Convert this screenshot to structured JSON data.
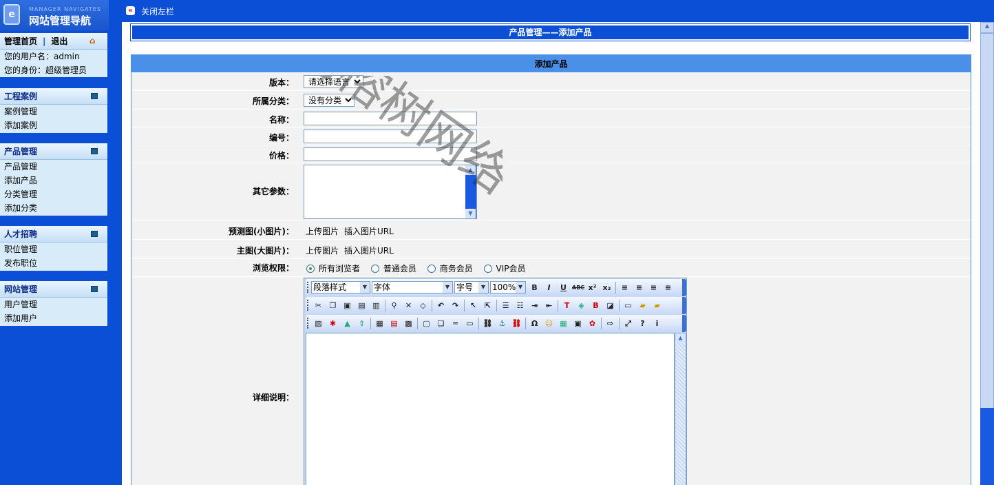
{
  "logo": {
    "sub": "MANAGER NAVIGATES",
    "title": "网站管理导航"
  },
  "sidebar": {
    "home": {
      "home_label": "管理首页",
      "logout_label": "退出",
      "username": "您的用户名：admin",
      "role": "您的身份：超级管理员"
    },
    "sections": [
      {
        "title": "工程案例",
        "items": [
          "案例管理",
          "添加案例"
        ]
      },
      {
        "title": "产品管理",
        "items": [
          "产品管理",
          "添加产品",
          "分类管理",
          "添加分类"
        ]
      },
      {
        "title": "人才招聘",
        "items": [
          "职位管理",
          "发布职位"
        ]
      },
      {
        "title": "网站管理",
        "items": [
          "用户管理",
          "添加用户"
        ]
      }
    ]
  },
  "topbar": {
    "close_label": "关闭左栏"
  },
  "page": {
    "title": "产品管理——添加产品"
  },
  "form": {
    "header": "添加产品",
    "version_label": "版本：",
    "version_value": "请选择语言",
    "category_label": "所属分类：",
    "category_value": "没有分类",
    "name_label": "名称：",
    "code_label": "编号：",
    "price_label": "价格：",
    "params_label": "其它参数：",
    "preview_label": "预测图(小图片)：",
    "main_label": "主图(大图片)：",
    "upload_label": "上传图片",
    "insert_url_label": "插入图片URL",
    "perm_label": "浏览权限：",
    "perm_options": [
      "所有浏览者",
      "普通会员",
      "商务会员",
      "VIP会员"
    ],
    "perm_selected": 0,
    "detail_label": "详细说明："
  },
  "editor": {
    "paragraph_style": "段落样式",
    "font": "字体",
    "size": "字号",
    "zoom": "100%"
  },
  "watermark": "老榕树网络"
}
